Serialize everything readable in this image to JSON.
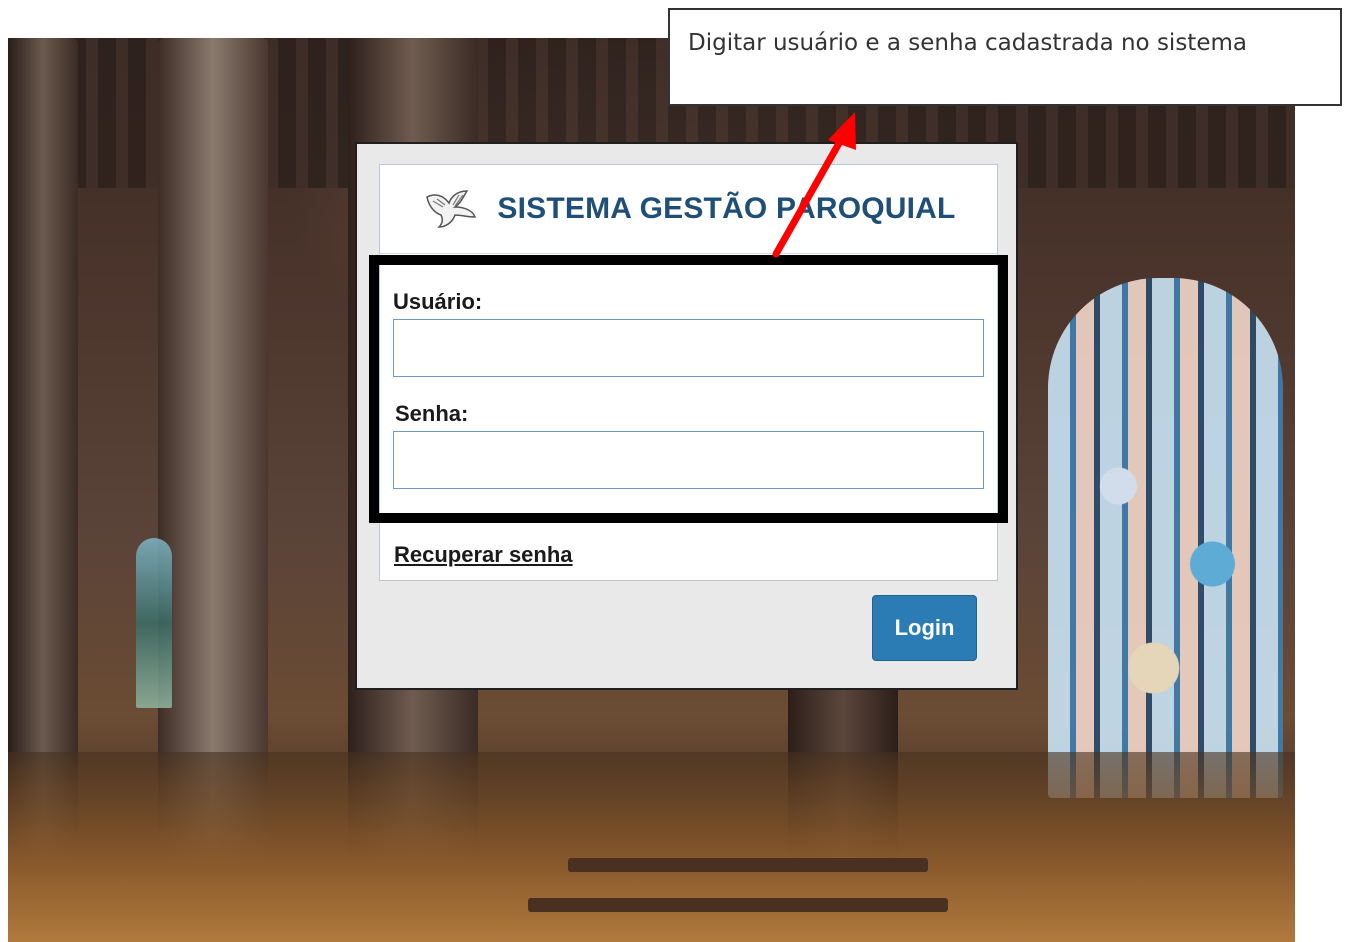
{
  "callout": {
    "text": "Digitar usuário e a senha cadastrada no sistema"
  },
  "login": {
    "title": "SISTEMA GESTÃO PAROQUIAL",
    "logo_icon": "dove-icon",
    "username_label": "Usuário:",
    "username_value": "",
    "password_label": "Senha:",
    "password_value": "",
    "recover_link": "Recuperar senha",
    "login_button": "Login"
  },
  "colors": {
    "title": "#1f4f78",
    "button": "#2b7bb4",
    "highlight": "#000000",
    "arrow": "#ff0000"
  }
}
